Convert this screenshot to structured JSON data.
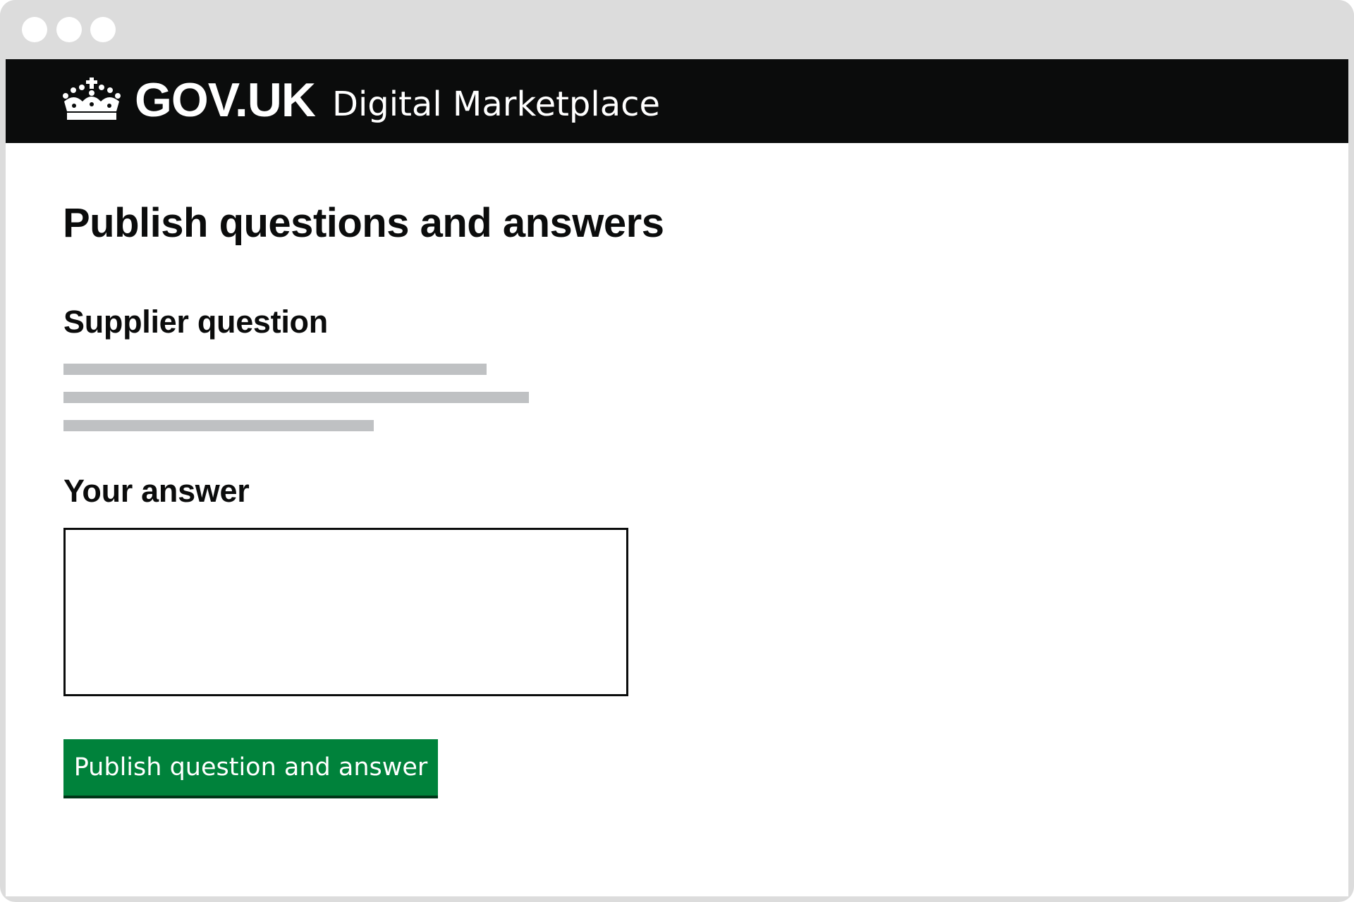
{
  "window": {
    "controls": [
      "close-dot",
      "minimize-dot",
      "maximize-dot"
    ]
  },
  "header": {
    "brand": "GOV.UK",
    "service": "Digital Marketplace",
    "logo_icon": "crown-icon",
    "background_color": "#0b0c0c"
  },
  "page": {
    "title": "Publish questions and answers"
  },
  "question": {
    "heading": "Supplier question",
    "placeholder_line_count": 3
  },
  "answer": {
    "heading": "Your answer",
    "value": ""
  },
  "actions": {
    "publish_label": "Publish question and answer",
    "publish_color": "#00823b"
  }
}
